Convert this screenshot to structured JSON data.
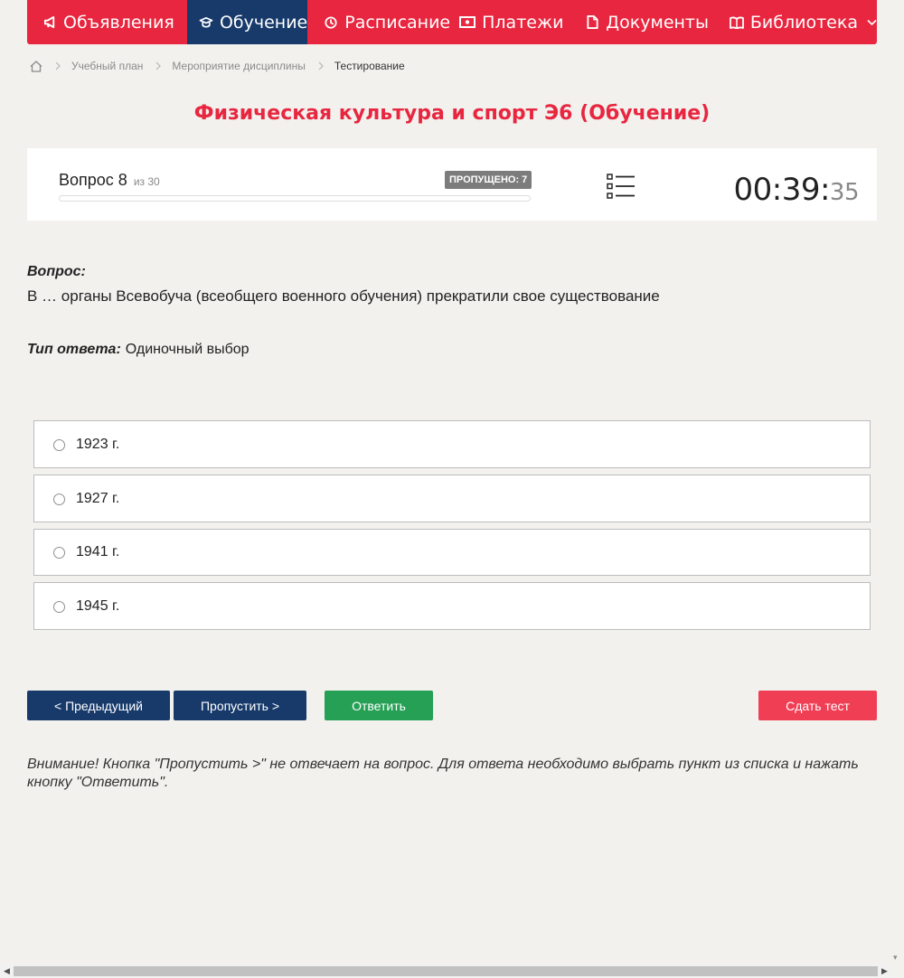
{
  "nav": {
    "items": [
      {
        "label": "Объявления",
        "icon": "megaphone-icon"
      },
      {
        "label": "Обучение",
        "icon": "graduation-cap-icon",
        "active": true
      },
      {
        "label": "Расписание",
        "icon": "clock-icon"
      },
      {
        "label": "Платежи",
        "icon": "money-icon"
      },
      {
        "label": "Документы",
        "icon": "document-icon"
      },
      {
        "label": "Библиотека",
        "icon": "book-icon",
        "dropdown": true
      }
    ],
    "accent_color": "#e8263f",
    "active_color": "#173a6b"
  },
  "breadcrumb": {
    "home_icon": "home-icon",
    "items": [
      "Учебный план",
      "Мероприятие дисциплины",
      "Тестирование"
    ]
  },
  "page_title": "Физическая культура и спорт Э6 (Обучение)",
  "status": {
    "question_label": "Вопрос 8",
    "of_total": "из 30",
    "skipped": "ПРОПУЩЕНО: 7",
    "progress_fraction": 0,
    "timer_main": "00:39:",
    "timer_seconds": "35"
  },
  "question": {
    "heading": "Вопрос:",
    "text": "В … органы Всевобуча (всеобщего военного обучения) прекратили свое существование",
    "answer_type_label": "Тип ответа:",
    "answer_type_value": "Одиночный выбор"
  },
  "options": [
    {
      "label": "1923 г."
    },
    {
      "label": "1927 г."
    },
    {
      "label": "1941 г."
    },
    {
      "label": "1945 г."
    }
  ],
  "buttons": {
    "prev": "< Предыдущий",
    "skip": "Пропустить >",
    "answer": "Ответить",
    "submit": "Сдать тест"
  },
  "warning": "Внимание! Кнопка \"Пропустить >\" не отвечает на вопрос. Для ответа необходимо выбрать пункт из списка и нажать кнопку \"Ответить\"."
}
